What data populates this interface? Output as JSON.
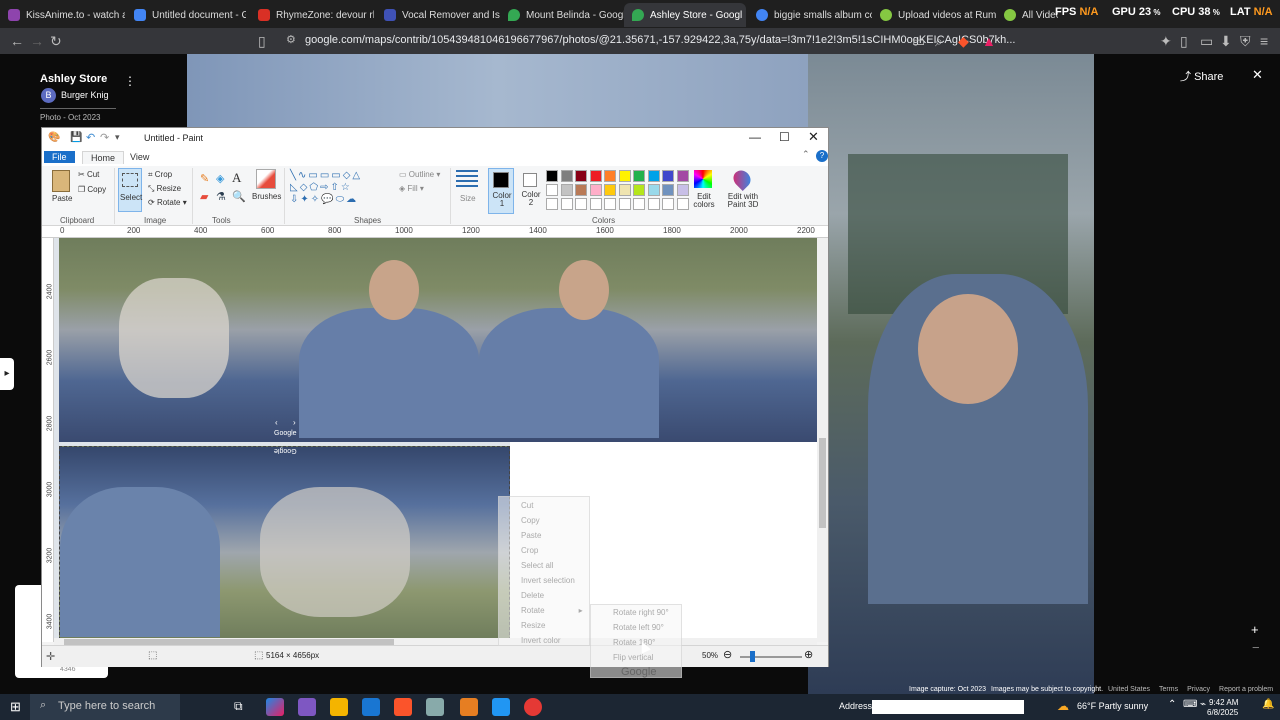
{
  "browser": {
    "tabs": [
      {
        "label": "KissAnime.to - watch anim",
        "color": "#8e44ad"
      },
      {
        "label": "Untitled document - Goo",
        "color": "#4285f4"
      },
      {
        "label": "RhymeZone: devour rhym",
        "color": "#d93025"
      },
      {
        "label": "Vocal Remover and Isolat",
        "color": "#3f51b5"
      },
      {
        "label": "Mount Belinda - Google",
        "color": "#34a853"
      },
      {
        "label": "Ashley Store - Googl",
        "color": "#34a853"
      },
      {
        "label": "biggie smalls album cove",
        "color": "#4285f4"
      },
      {
        "label": "Upload videos at Rumble",
        "color": "#85c742"
      },
      {
        "label": "All Videos",
        "color": "#85c742"
      }
    ],
    "stats": {
      "fps_label": "FPS",
      "fps": "N/A",
      "gpu_label": "GPU",
      "gpu": "23",
      "cpu_label": "CPU",
      "cpu": "38",
      "lat_label": "LAT",
      "lat": "N/A"
    },
    "url": "google.com/maps/contrib/105439481046196677967/photos/@21.35671,-157.929422,3a,75y/data=!3m7!1e2!3m5!1sCIHM0ogKEICAgICS0b7kh..."
  },
  "maps": {
    "place_title": "Ashley Store",
    "contributor_initial": "B",
    "contributor": "Burger Knig",
    "photo_date": "Photo - Oct 2023",
    "share": "Share",
    "image_capture": "Image capture: Oct 2023",
    "copyright": "Images may be subject to copyright.",
    "footer_links": [
      "United States",
      "Terms",
      "Privacy",
      "Report a problem"
    ],
    "count": "4346"
  },
  "paint": {
    "title": "Untitled - Paint",
    "menu": [
      "File",
      "Home",
      "View"
    ],
    "clipboard": {
      "paste": "Paste",
      "cut": "Cut",
      "copy": "Copy",
      "group": "Clipboard"
    },
    "image": {
      "select": "Select",
      "crop": "Crop",
      "resize": "Resize",
      "rotate": "Rotate",
      "group": "Image"
    },
    "tools_group": "Tools",
    "brushes": "Brushes",
    "shapes": {
      "outline": "Outline",
      "fill": "Fill",
      "group": "Shapes"
    },
    "size": "Size",
    "color1": "Color 1",
    "color2": "Color 2",
    "colors_group": "Colors",
    "edit_colors": "Edit colors",
    "edit_paint3d": "Edit with Paint 3D",
    "palette": [
      "#000000",
      "#7f7f7f",
      "#880015",
      "#ed1c24",
      "#ff7f27",
      "#fff200",
      "#22b14c",
      "#00a2e8",
      "#3f48cc",
      "#a349a4",
      "#ffffff",
      "#c3c3c3",
      "#b97a57",
      "#ffaec9",
      "#ffc90e",
      "#efe4b0",
      "#b5e61d",
      "#99d9ea",
      "#7092be",
      "#c8bfe7"
    ],
    "ruler_ticks": [
      "0",
      "200",
      "400",
      "600",
      "800",
      "1000",
      "1200",
      "1400",
      "1600",
      "1800",
      "2000",
      "2200"
    ],
    "vruler_ticks": [
      "2400",
      "2600",
      "2800",
      "3000",
      "3200",
      "3400"
    ],
    "dimensions": "5164 × 4656px",
    "zoom": "50%",
    "google_wm": "Google"
  },
  "context_menu": [
    "Cut",
    "Copy",
    "Paste",
    "Crop",
    "Select all",
    "Invert selection",
    "Delete",
    "Rotate",
    "Resize",
    "Invert color"
  ],
  "rotate_submenu": [
    "Rotate right 90°",
    "Rotate left 90°",
    "Rotate 180°",
    "Flip vertical"
  ],
  "taskbar": {
    "search": "Type here to search",
    "address": "Address",
    "weather": "66°F  Partly sunny",
    "time": "9:42 AM",
    "date": "6/8/2025"
  }
}
